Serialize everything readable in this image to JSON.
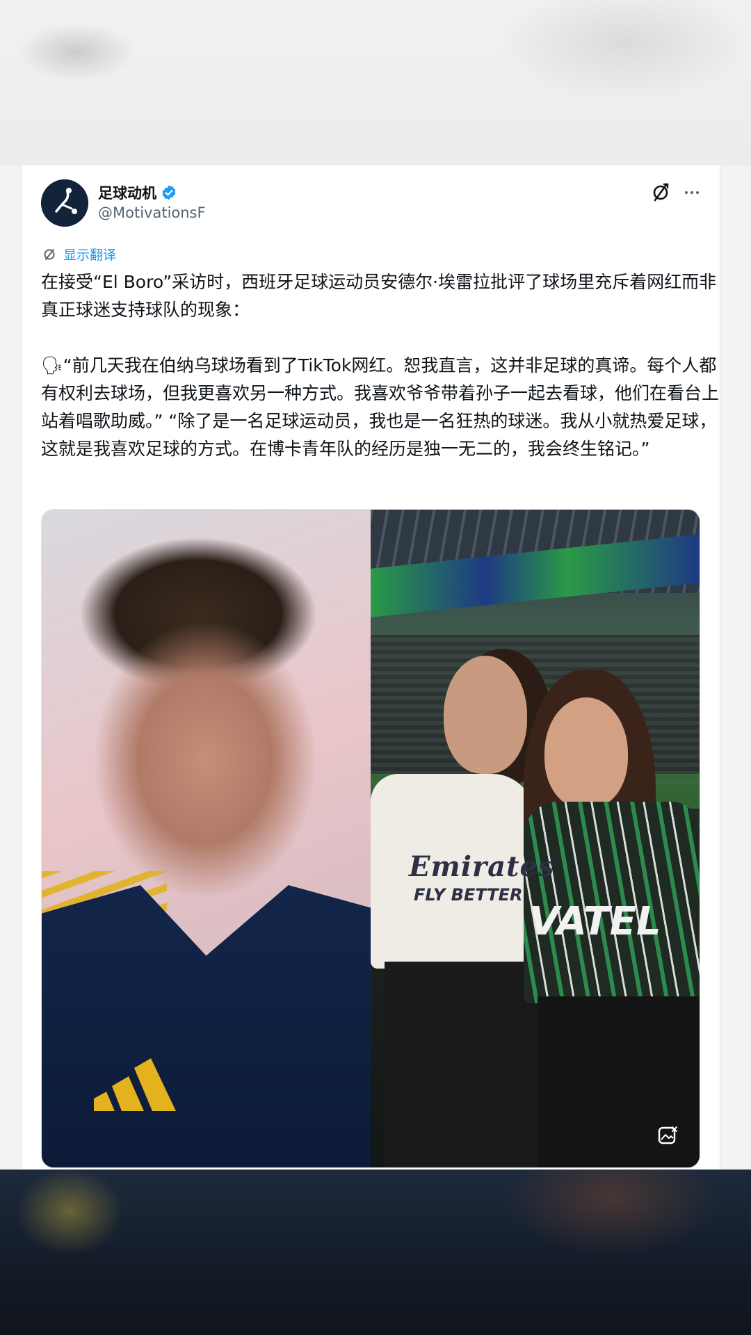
{
  "post": {
    "author": {
      "display_name": "足球动机",
      "handle": "@MotivationsF",
      "verified": true
    },
    "translate_label": "显示翻译",
    "text": "在接受“El Boro”采访时，西班牙足球运动员安德尔·埃雷拉批评了球场里充斥着网红而非真正球迷支持球队的现象：\n\n🗣“前几天我在伯纳乌球场看到了TikTok网红。恕我直言，这并非足球的真谛。每个人都有权利去球场，但我更喜欢另一种方式。我喜欢爷爷带着孙子一起去看球，他们在看台上站着唱歌助威。” “除了是一名足球运动员，我也是一名狂热的球迷。我从小就热爱足球，这就是我喜欢足球的方式。在博卡青年队的经历是独一无二的，我会终生铭记。”",
    "media": {
      "left_photo": {
        "shirt_logo": "adidas"
      },
      "right_photo": {
        "shirt_a_text": "Emirates",
        "shirt_a_sub": "FLY BETTER",
        "shirt_b_text": "VATEL"
      }
    }
  },
  "icons": {
    "verified": "verified-badge-icon",
    "translate": "translate-icon",
    "more": "more-options-icon",
    "alt": "alt-text-icon"
  },
  "colors": {
    "link": "#1d9bf0",
    "text": "#0f1419",
    "secondary": "#536471"
  }
}
